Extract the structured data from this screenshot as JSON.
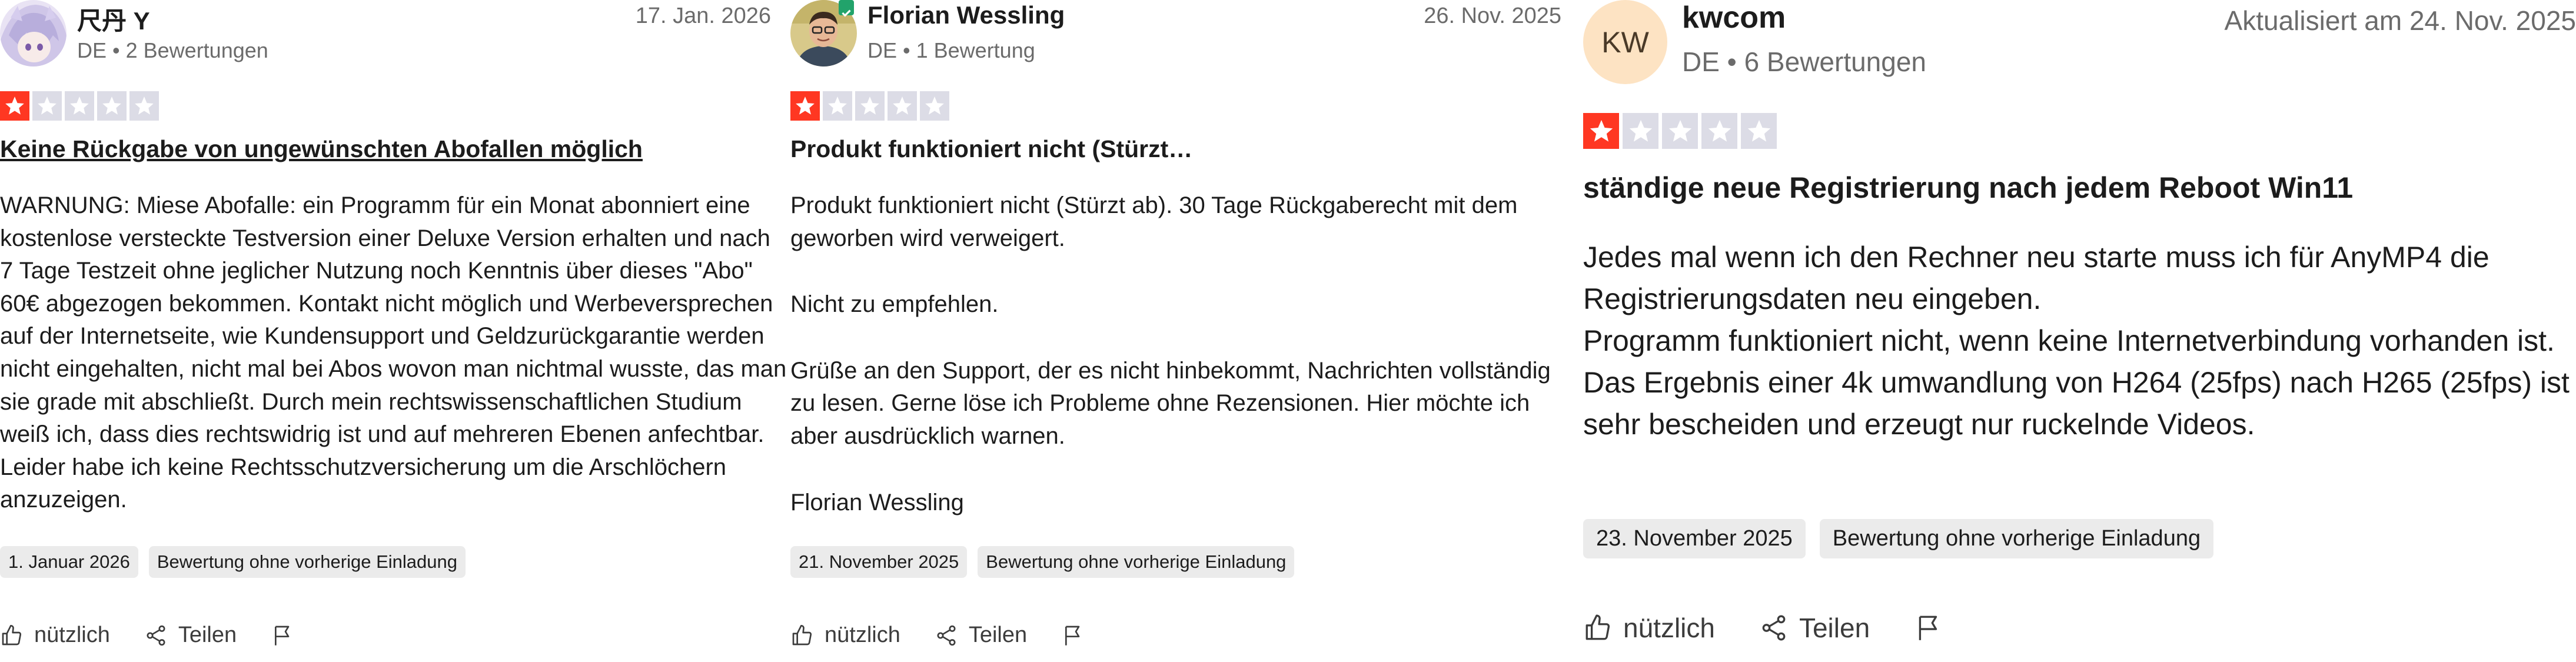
{
  "colors": {
    "star_on": "#ff3722",
    "star_off": "#dcdce6",
    "tag_bg": "#ebebeb",
    "muted_text": "#6b6b6b",
    "avatar_kw_bg": "#fde3c3"
  },
  "reviews": [
    {
      "author": "尺丹 Y",
      "meta": "DE • 2 Bewertungen",
      "date": "17. Jan. 2026",
      "rating": 1,
      "title": "Keine Rückgabe von ungewünschten Abofallen möglich",
      "body": [
        "WARNUNG: Miese Abofalle: ein Programm für ein Monat abonniert eine kostenlose versteckte Testversion einer Deluxe Version erhalten und nach 7 Tage Testzeit ohne jeglicher Nutzung noch Kenntnis über dieses \"Abo\" 60€ abgezogen bekommen. Kontakt nicht möglich und Werbeversprechen auf der Internetseite, wie Kundensupport und Geldzurückgarantie werden nicht eingehalten, nicht mal bei Abos wovon man nichtmal wusste, das man sie grade mit abschließt. Durch mein rechtswissenschaftlichen Studium weiß ich, dass dies rechtswidrig ist und auf mehreren Ebenen anfechtbar. Leider habe ich keine Rechtsschutzversicherung um die Arschlöchern anzuzeigen."
      ],
      "experience_date": "1. Januar 2026",
      "invitation_tag": "Bewertung ohne vorherige Einladung",
      "useful_label": "nützlich",
      "share_label": "Teilen",
      "avatar_icon": "anime-avatar-icon"
    },
    {
      "author": "Florian Wessling",
      "meta": "DE • 1 Bewertung",
      "date": "26. Nov. 2025",
      "rating": 1,
      "title": "Produkt funktioniert nicht (Stürzt…",
      "body": [
        "Produkt funktioniert nicht (Stürzt ab). 30 Tage Rückgaberecht mit dem geworben wird verweigert.",
        "",
        "Nicht zu empfehlen.",
        "",
        "Grüße an den Support, der es nicht hinbekommt, Nachrichten vollständig zu lesen. Gerne löse ich Probleme ohne Rezensionen. Hier möchte ich aber ausdrücklich warnen.",
        "",
        "Florian Wessling"
      ],
      "experience_date": "21. November 2025",
      "invitation_tag": "Bewertung ohne vorherige Einladung",
      "useful_label": "nützlich",
      "share_label": "Teilen",
      "avatar_icon": "profile-photo-icon"
    },
    {
      "author": "kwcom",
      "avatar_initials": "KW",
      "meta": "DE • 6 Bewertungen",
      "date": "Aktualisiert am 24. Nov. 2025",
      "rating": 1,
      "title": "ständige neue Registrierung nach jedem Reboot Win11",
      "body": [
        "Jedes mal wenn ich den Rechner neu starte muss ich für AnyMP4 die Registrierungsdaten neu eingeben.",
        "Programm funktioniert nicht, wenn keine Internetverbindung vorhanden ist.",
        "Das Ergebnis einer 4k umwandlung von H264 (25fps) nach H265 (25fps) ist sehr bescheiden und erzeugt nur ruckelnde Videos."
      ],
      "experience_date": "23. November 2025",
      "invitation_tag": "Bewertung ohne vorherige Einladung",
      "useful_label": "nützlich",
      "share_label": "Teilen"
    }
  ]
}
